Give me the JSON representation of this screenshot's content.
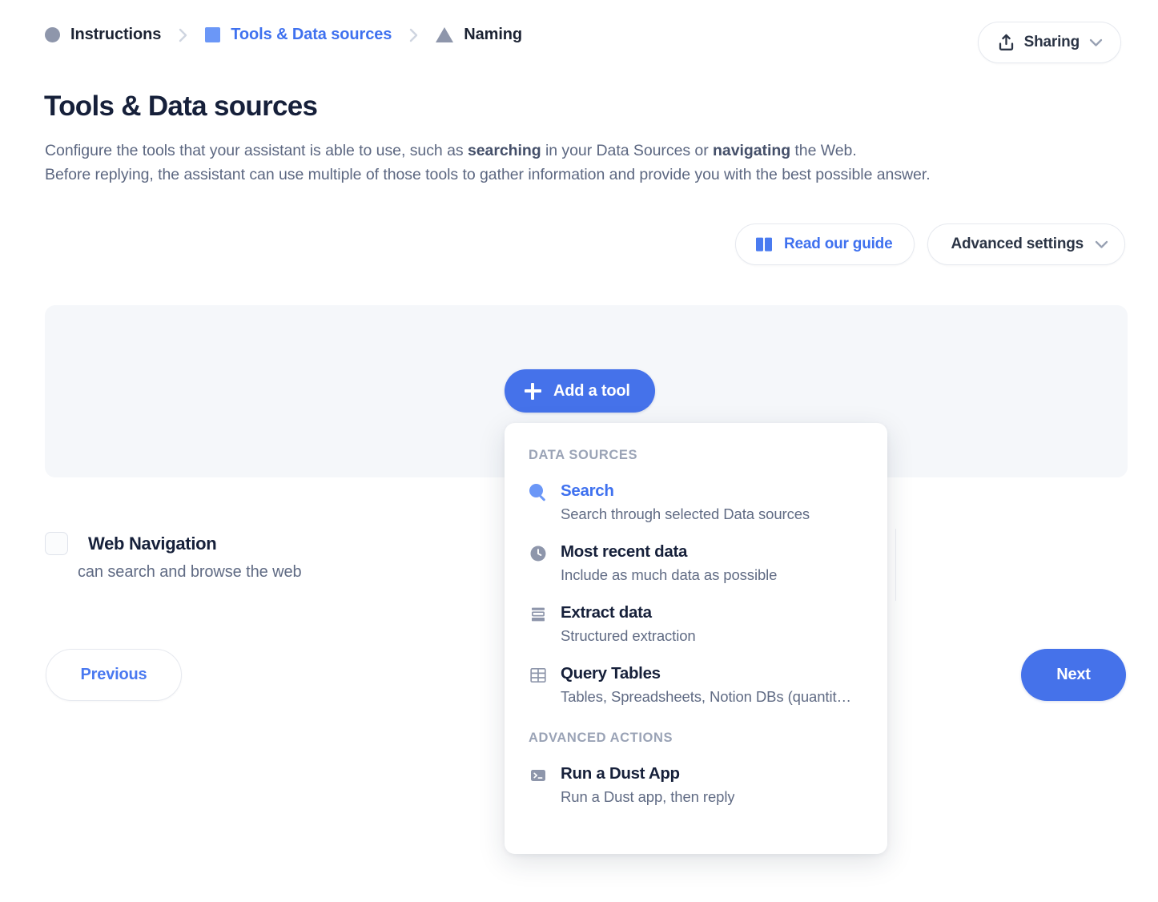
{
  "breadcrumb": {
    "items": [
      {
        "label": "Instructions",
        "shape": "circle",
        "active": false
      },
      {
        "label": "Tools & Data sources",
        "shape": "square",
        "active": true
      },
      {
        "label": "Naming",
        "shape": "triangle",
        "active": false
      }
    ],
    "separator": "chevron-right-icon"
  },
  "header": {
    "sharing_label": "Sharing",
    "sharing_icon": "share-upload-icon",
    "sharing_chevron": "chevron-down-icon"
  },
  "page": {
    "title": "Tools & Data sources",
    "description_line1_pre": "Configure the tools that your assistant is able to use, such as ",
    "description_line1_b1": "searching",
    "description_line1_mid": " in your Data Sources or ",
    "description_line1_b2": "navigating",
    "description_line1_post": " the Web.",
    "description_line2": "Before replying, the assistant can use multiple of those tools to gather information and provide you with the best possible answer."
  },
  "actions": {
    "read_guide_label": "Read our guide",
    "read_guide_icon": "book-icon",
    "advanced_settings_label": "Advanced settings",
    "advanced_settings_chevron": "chevron-down-icon",
    "add_tool_label": "Add a tool",
    "add_tool_icon": "plus-icon"
  },
  "web_navigation": {
    "title": "Web Navigation",
    "description": "can search and browse the web",
    "checked": false
  },
  "footer": {
    "previous_label": "Previous",
    "next_label": "Next"
  },
  "menu": {
    "sections": [
      {
        "label": "DATA SOURCES",
        "items": [
          {
            "title": "Search",
            "desc": "Search through selected Data sources",
            "icon": "search-icon",
            "active": true
          },
          {
            "title": "Most recent data",
            "desc": "Include as much data as possible",
            "icon": "clock-icon",
            "active": false
          },
          {
            "title": "Extract data",
            "desc": "Structured extraction",
            "icon": "extract-icon",
            "active": false
          },
          {
            "title": "Query Tables",
            "desc": "Tables, Spreadsheets, Notion DBs (quantit…",
            "icon": "table-icon",
            "active": false
          }
        ]
      },
      {
        "label": "ADVANCED ACTIONS",
        "items": [
          {
            "title": "Run a Dust App",
            "desc": "Run a Dust app, then reply",
            "icon": "terminal-icon",
            "active": false
          }
        ]
      }
    ]
  },
  "colors": {
    "accent_blue": "#4572ea",
    "link_blue": "#3f71ef",
    "icon_blue": "#6b97f7",
    "gray_shape": "#8e96ab",
    "panel_bg": "#f5f7fa",
    "text_dark": "#16203a",
    "text_muted": "#606b84"
  }
}
